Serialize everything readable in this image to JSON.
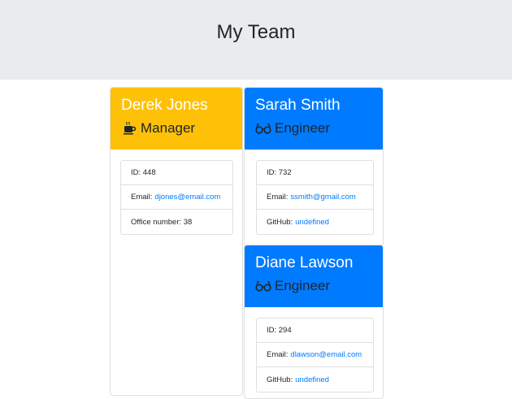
{
  "header": {
    "title": "My Team"
  },
  "cards": [
    {
      "name": "Derek Jones",
      "role": "Manager",
      "role_icon": "coffee-mug-icon",
      "color": "#ffc107",
      "id_label": "ID: 448",
      "email_label": "Email:",
      "email": "djones@email.com",
      "extra_label": "Office number: 38"
    },
    {
      "name": "Sarah Smith",
      "role": "Engineer",
      "role_icon": "glasses-icon",
      "color": "#007bff",
      "id_label": "ID: 732",
      "email_label": "Email:",
      "email": "ssmith@gmail.com",
      "extra_label": "GitHub:",
      "extra_link": "undefined"
    },
    {
      "name": "Diane Lawson",
      "role": "Engineer",
      "role_icon": "glasses-icon",
      "color": "#007bff",
      "id_label": "ID: 294",
      "email_label": "Email:",
      "email": "dlawson@email.com",
      "extra_label": "GitHub:",
      "extra_link": "undefined"
    }
  ]
}
